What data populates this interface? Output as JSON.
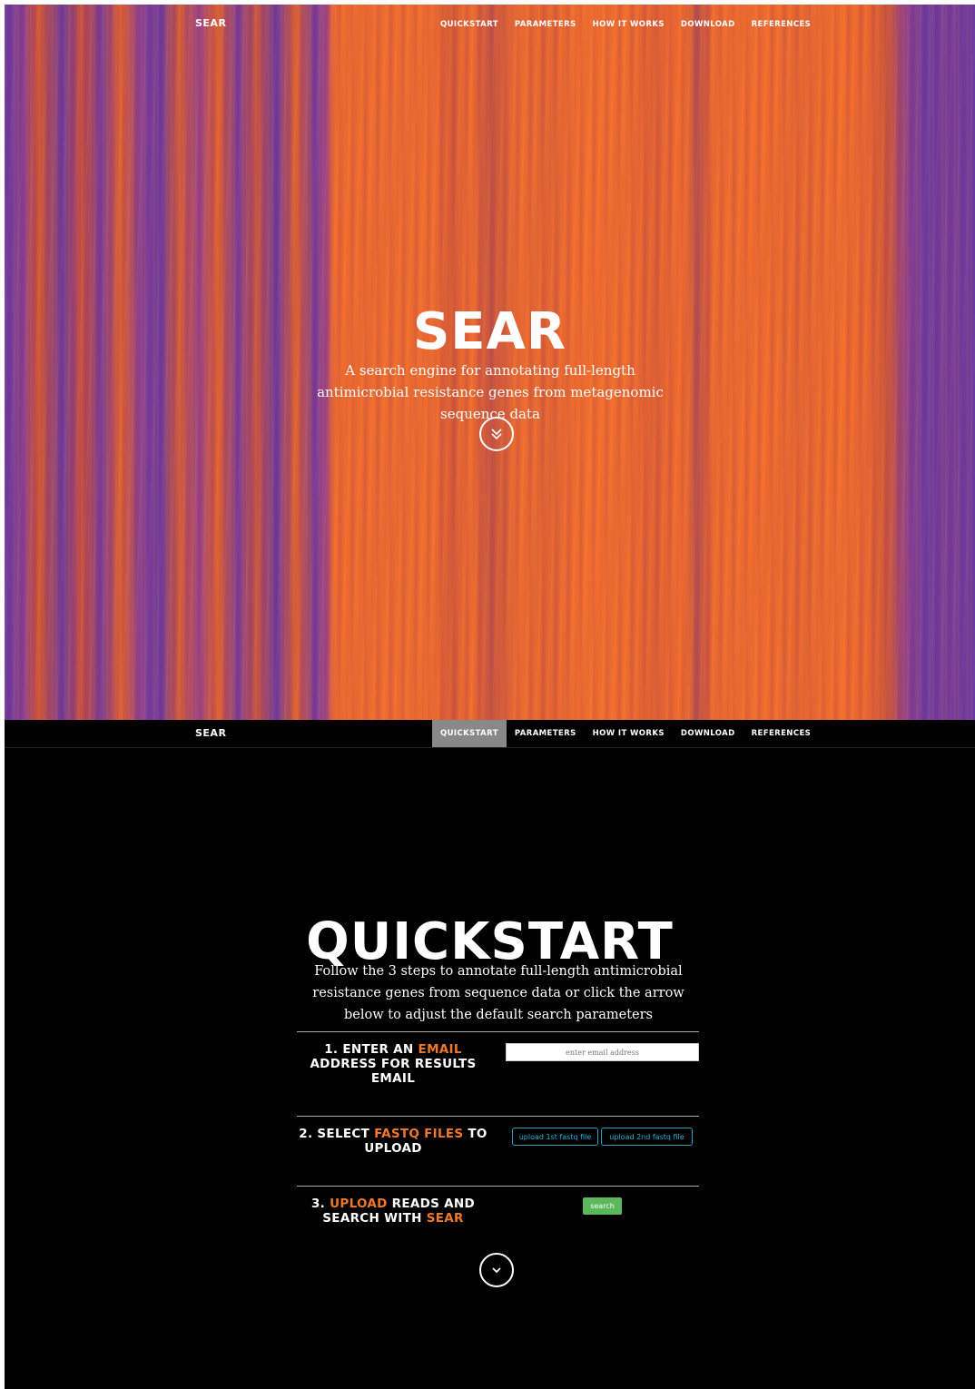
{
  "brand": "SEAR",
  "nav": {
    "items": [
      "QUICKSTART",
      "PARAMETERS",
      "HOW IT WORKS",
      "DOWNLOAD",
      "REFERENCES"
    ],
    "active": "QUICKSTART"
  },
  "hero": {
    "title": "SEAR",
    "subtitle": "A search engine for annotating full-length antimicrobial resistance genes from metagenomic sequence data"
  },
  "quickstart": {
    "title": "QUICKSTART",
    "intro": "Follow the 3 steps to annotate full-length antimicrobial resistance genes from sequence data or click the arrow below to adjust the default search parameters",
    "step1": {
      "prefix": "1. ENTER AN ",
      "highlight": "EMAIL",
      "suffix": " ADDRESS FOR RESULTS EMAIL",
      "email_placeholder": "enter email address"
    },
    "step2": {
      "prefix": "2. SELECT ",
      "highlight": "FASTQ FILES",
      "suffix": " TO UPLOAD",
      "upload1": "upload 1st fastq file",
      "upload2": "upload 2nd fastq file"
    },
    "step3": {
      "prefix": "3. ",
      "highlight1": "UPLOAD",
      "middle": " READS AND SEARCH WITH ",
      "highlight2": "SEAR",
      "search_label": "search"
    }
  },
  "colors": {
    "accent_orange": "#f0782a",
    "button_blue": "#2ab0d8",
    "search_green": "#5cb85c",
    "active_nav_bg": "#888888"
  }
}
